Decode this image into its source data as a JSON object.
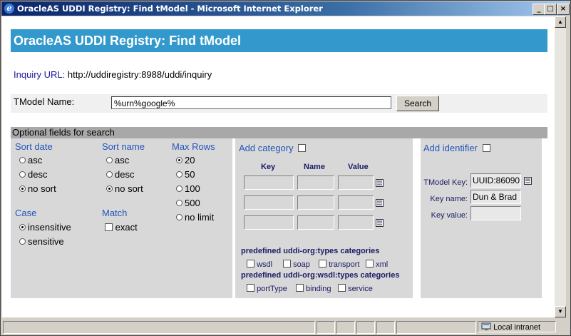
{
  "window": {
    "title": "OracleAS UDDI Registry: Find tModel - Microsoft Internet Explorer",
    "minimize": "_",
    "maximize": "□",
    "close": "×"
  },
  "page": {
    "header": "OracleAS UDDI Registry: Find tModel",
    "inquiry_label": "Inquiry URL:",
    "inquiry_url": "http://uddiregistry:8988/uddi/inquiry",
    "tmodel_label": "TModel Name:",
    "tmodel_value": "%urn%google%",
    "search_label": "Search",
    "optional_header": "Optional fields for search"
  },
  "sort_date": {
    "title": "Sort date",
    "options": [
      "asc",
      "desc",
      "no sort"
    ],
    "selected": "no sort"
  },
  "sort_name": {
    "title": "Sort name",
    "options": [
      "asc",
      "desc",
      "no sort"
    ],
    "selected": "no sort"
  },
  "max_rows": {
    "title": "Max Rows",
    "options": [
      "20",
      "50",
      "100",
      "500",
      "no limit"
    ],
    "selected": "20"
  },
  "case": {
    "title": "Case",
    "options": [
      "insensitive",
      "sensitive"
    ],
    "selected": "insensitive"
  },
  "match": {
    "title": "Match",
    "exact_label": "exact"
  },
  "category": {
    "title": "Add category",
    "col_key": "Key",
    "col_name": "Name",
    "col_value": "Value",
    "types_header": "predefined uddi-org:types categories",
    "types_options": [
      "wsdl",
      "soap",
      "transport",
      "xml"
    ],
    "wsdl_header": "predefined uddi-org:wsdl:types categories",
    "wsdl_options": [
      "portType",
      "binding",
      "service"
    ]
  },
  "identifier": {
    "title": "Add identifier",
    "tmodel_key_label": "TModel Key:",
    "tmodel_key_value": "UUID:86090",
    "key_name_label": "Key name:",
    "key_name_value": "Dun & Brad",
    "key_value_label": "Key value:",
    "key_value_value": ""
  },
  "status": {
    "zone": "Local intranet"
  },
  "colors": {
    "header_bg": "#3399cc",
    "section_text": "#2255bb",
    "panel_bg": "#d8d8d8"
  }
}
